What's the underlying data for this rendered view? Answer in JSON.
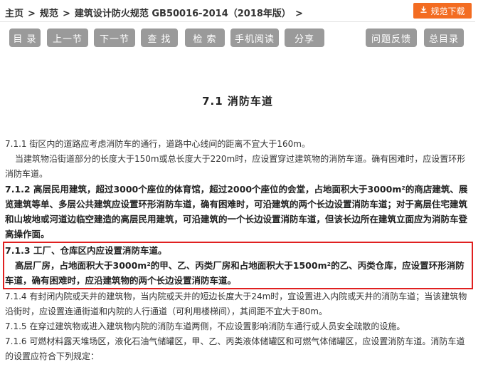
{
  "breadcrumb": {
    "items": [
      "主页",
      "规范",
      "建筑设计防火规范 GB50016-2014（2018年版）"
    ],
    "separator": ">"
  },
  "download_button": {
    "label": "规范下载",
    "icon": "download-icon",
    "color": "#f36c21"
  },
  "toolbar": {
    "buttons": [
      "目 录",
      "上一节",
      "下一节",
      "查 找",
      "检 索",
      "手机阅读",
      "分享",
      "问题反馈",
      "总目录"
    ],
    "button_color": "#9a9a9a"
  },
  "section_title": "7.1 消防车道",
  "paragraphs": {
    "p711a": "7.1.1 街区内的道路应考虑消防车的通行，道路中心线间的距离不宜大于160m。",
    "p711b": "当建筑物沿街道部分的长度大于150m或总长度大于220m时，应设置穿过建筑物的消防车道。确有困难时，应设置环形消防车道。",
    "p712": "7.1.2 高层民用建筑，超过3000个座位的体育馆，超过2000个座位的会堂，占地面积大于3000m²的商店建筑、展览建筑等单、多层公共建筑应设置环形消防车道，确有困难时，可沿建筑的两个长边设置消防车道；对于高层住宅建筑和山坡地或河道边临空建造的高层民用建筑，可沿建筑的一个长边设置消防车道，但该长边所在建筑立面应为消防车登高操作面。",
    "p713a": "7.1.3 工厂、仓库区内应设置消防车道。",
    "p713b": "高层厂房，占地面积大于3000m²的甲、乙、丙类厂房和占地面积大于1500m²的乙、丙类仓库，应设置环形消防车道，确有困难时，应沿建筑物的两个长边设置消防车道。",
    "p714": "7.1.4 有封闭内院或天井的建筑物，当内院或天井的短边长度大于24m时，宜设置进入内院或天井的消防车道；当该建筑物沿街时，应设置连通街道和内院的人行通道（可利用楼梯间），其间距不宜大于80m。",
    "p715": "7.1.5 在穿过建筑物或进入建筑物内院的消防车道两侧，不应设置影响消防车通行或人员安全疏散的设施。",
    "p716": "7.1.6 可燃材料露天堆场区，液化石油气储罐区，甲、乙、丙类液体储罐区和可燃气体储罐区，应设置消防车道。消防车道的设置应符合下列规定："
  },
  "highlight_color": "#e02020"
}
